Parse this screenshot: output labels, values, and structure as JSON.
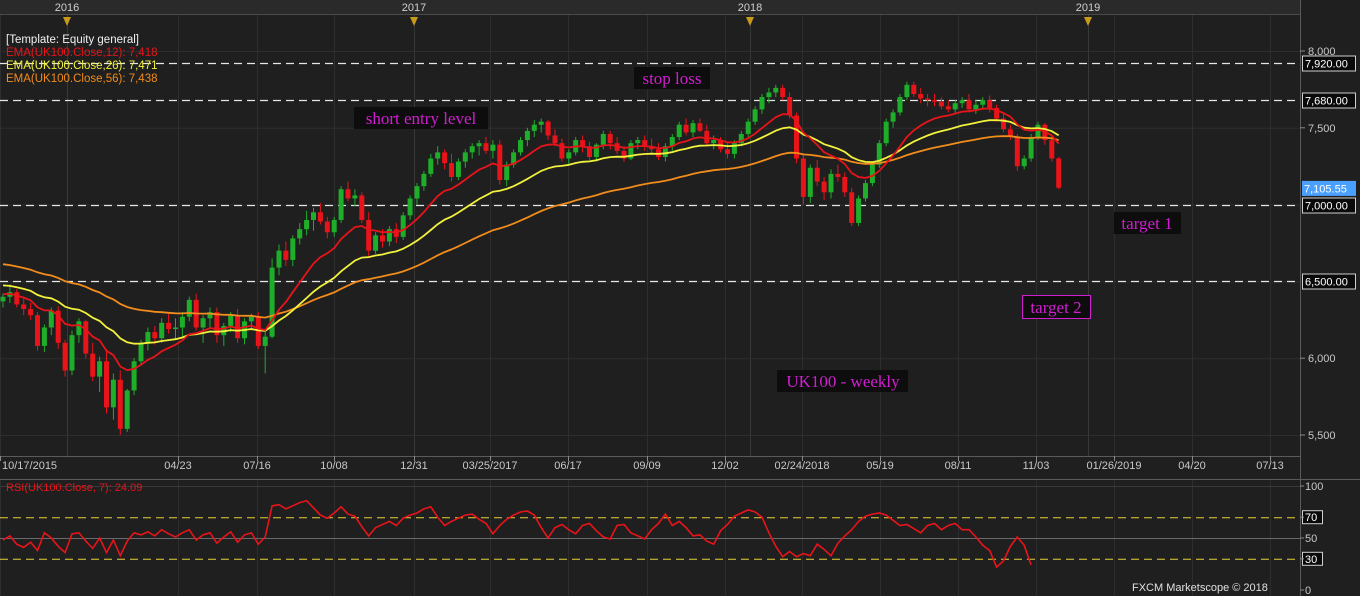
{
  "template_label": "[Template: Equity general]",
  "ema_legend": [
    {
      "label": "EMA(UK100.Close,12): 7,418",
      "color": "#e8141a"
    },
    {
      "label": "EMA(UK100.Close,26): 7,471",
      "color": "#f2f23c"
    },
    {
      "label": "EMA(UK100.Close,56): 7,438",
      "color": "#f28c1c"
    }
  ],
  "year_markers": [
    "2016",
    "2017",
    "2018",
    "2019"
  ],
  "date_labels": [
    "10/17/2015",
    "04/23",
    "07/16",
    "10/08",
    "12/31",
    "03/25/2017",
    "06/17",
    "09/09",
    "12/02",
    "02/24/2018",
    "05/19",
    "08/11",
    "11/03",
    "01/26/2019",
    "04/20",
    "07/13"
  ],
  "annotations": {
    "stop_loss": "stop loss",
    "short_entry": "short entry level",
    "target1": "target 1",
    "target2": "target 2",
    "title": "UK100 - weekly"
  },
  "levels": [
    {
      "value": 7920,
      "label": "7,920.00"
    },
    {
      "value": 7680,
      "label": "7,680.00"
    },
    {
      "value": 7000,
      "label": "7,000.00"
    },
    {
      "value": 6500,
      "label": "6,500.00"
    }
  ],
  "current_price": {
    "value": 7105.55,
    "label": "7,105.55"
  },
  "price_ticks": [
    {
      "value": 8000,
      "label": "8,000"
    },
    {
      "value": 7500,
      "label": "7,500"
    },
    {
      "value": 6000,
      "label": "6,000"
    },
    {
      "value": 5500,
      "label": "5,500"
    }
  ],
  "rsi_label": "RSI(UK100.Close, 7): 24.09",
  "rsi_ticks": [
    {
      "value": 100,
      "label": "100"
    },
    {
      "value": 70,
      "label": "70"
    },
    {
      "value": 50,
      "label": "50"
    },
    {
      "value": 30,
      "label": "30"
    },
    {
      "value": 0,
      "label": "0"
    }
  ],
  "watermark": "FXCM Marketscope © 2018",
  "colors": {
    "up": "#1fae2a",
    "down": "#e8141a",
    "rsi": "#e8141a",
    "annotation": "#d21ed2",
    "current": "#4aa0ff"
  },
  "chart_data": {
    "type": "candlestick",
    "title": "UK100 - weekly",
    "price_range": [
      5500,
      8060
    ],
    "rsi_range": [
      0,
      100
    ],
    "ohlc": [
      [
        6370,
        6420,
        6330,
        6400
      ],
      [
        6400,
        6480,
        6360,
        6430
      ],
      [
        6430,
        6450,
        6330,
        6350
      ],
      [
        6350,
        6390,
        6280,
        6320
      ],
      [
        6320,
        6360,
        6250,
        6280
      ],
      [
        6280,
        6300,
        6050,
        6080
      ],
      [
        6080,
        6220,
        6040,
        6200
      ],
      [
        6200,
        6330,
        6150,
        6310
      ],
      [
        6310,
        6340,
        6060,
        6100
      ],
      [
        6100,
        6120,
        5880,
        5920
      ],
      [
        5920,
        6180,
        5890,
        6150
      ],
      [
        6150,
        6260,
        6100,
        6240
      ],
      [
        6240,
        6250,
        6000,
        6030
      ],
      [
        6030,
        6100,
        5850,
        5880
      ],
      [
        5880,
        6010,
        5780,
        5980
      ],
      [
        5980,
        6060,
        5640,
        5680
      ],
      [
        5680,
        5900,
        5600,
        5860
      ],
      [
        5860,
        5920,
        5500,
        5540
      ],
      [
        5540,
        5800,
        5520,
        5790
      ],
      [
        5790,
        6000,
        5760,
        5980
      ],
      [
        5980,
        6120,
        5950,
        6100
      ],
      [
        6100,
        6200,
        6050,
        6170
      ],
      [
        6170,
        6210,
        6090,
        6130
      ],
      [
        6130,
        6260,
        6100,
        6230
      ],
      [
        6230,
        6300,
        6160,
        6190
      ],
      [
        6190,
        6260,
        6120,
        6200
      ],
      [
        6200,
        6300,
        6140,
        6270
      ],
      [
        6270,
        6400,
        6240,
        6380
      ],
      [
        6380,
        6420,
        6180,
        6200
      ],
      [
        6200,
        6280,
        6100,
        6260
      ],
      [
        6260,
        6330,
        6200,
        6300
      ],
      [
        6300,
        6330,
        6100,
        6150
      ],
      [
        6150,
        6230,
        6080,
        6210
      ],
      [
        6210,
        6300,
        6170,
        6280
      ],
      [
        6280,
        6320,
        6100,
        6130
      ],
      [
        6130,
        6260,
        6090,
        6240
      ],
      [
        6240,
        6290,
        6180,
        6270
      ],
      [
        6270,
        6300,
        6060,
        6080
      ],
      [
        6080,
        6170,
        5900,
        6140
      ],
      [
        6140,
        6650,
        6130,
        6590
      ],
      [
        6590,
        6740,
        6540,
        6700
      ],
      [
        6700,
        6760,
        6600,
        6640
      ],
      [
        6640,
        6800,
        6600,
        6780
      ],
      [
        6780,
        6880,
        6740,
        6840
      ],
      [
        6840,
        6960,
        6800,
        6900
      ],
      [
        6900,
        6980,
        6830,
        6950
      ],
      [
        6950,
        7010,
        6870,
        6890
      ],
      [
        6890,
        6920,
        6780,
        6820
      ],
      [
        6820,
        6920,
        6790,
        6900
      ],
      [
        6900,
        7120,
        6880,
        7100
      ],
      [
        7100,
        7150,
        7020,
        7040
      ],
      [
        7040,
        7100,
        6990,
        7060
      ],
      [
        7060,
        7080,
        6880,
        6900
      ],
      [
        6900,
        6950,
        6660,
        6700
      ],
      [
        6700,
        6820,
        6680,
        6800
      ],
      [
        6800,
        6840,
        6720,
        6760
      ],
      [
        6760,
        6860,
        6730,
        6840
      ],
      [
        6840,
        6880,
        6750,
        6790
      ],
      [
        6790,
        6950,
        6770,
        6930
      ],
      [
        6930,
        7060,
        6900,
        7040
      ],
      [
        7040,
        7140,
        7000,
        7120
      ],
      [
        7120,
        7220,
        7090,
        7200
      ],
      [
        7200,
        7330,
        7180,
        7300
      ],
      [
        7300,
        7380,
        7260,
        7340
      ],
      [
        7340,
        7360,
        7230,
        7270
      ],
      [
        7270,
        7330,
        7150,
        7180
      ],
      [
        7180,
        7300,
        7160,
        7280
      ],
      [
        7280,
        7360,
        7240,
        7340
      ],
      [
        7340,
        7400,
        7300,
        7380
      ],
      [
        7380,
        7420,
        7320,
        7400
      ],
      [
        7400,
        7440,
        7330,
        7350
      ],
      [
        7350,
        7420,
        7300,
        7390
      ],
      [
        7390,
        7420,
        7130,
        7160
      ],
      [
        7160,
        7280,
        7120,
        7260
      ],
      [
        7260,
        7360,
        7240,
        7340
      ],
      [
        7340,
        7440,
        7320,
        7420
      ],
      [
        7420,
        7500,
        7380,
        7480
      ],
      [
        7480,
        7550,
        7440,
        7520
      ],
      [
        7520,
        7560,
        7470,
        7540
      ],
      [
        7540,
        7550,
        7420,
        7450
      ],
      [
        7450,
        7490,
        7380,
        7400
      ],
      [
        7400,
        7430,
        7280,
        7300
      ],
      [
        7300,
        7360,
        7260,
        7340
      ],
      [
        7340,
        7440,
        7320,
        7420
      ],
      [
        7420,
        7450,
        7340,
        7380
      ],
      [
        7380,
        7410,
        7290,
        7310
      ],
      [
        7310,
        7400,
        7280,
        7390
      ],
      [
        7390,
        7480,
        7360,
        7460
      ],
      [
        7460,
        7480,
        7360,
        7400
      ],
      [
        7400,
        7440,
        7330,
        7350
      ],
      [
        7350,
        7380,
        7280,
        7300
      ],
      [
        7300,
        7420,
        7290,
        7400
      ],
      [
        7400,
        7440,
        7360,
        7420
      ],
      [
        7420,
        7450,
        7350,
        7380
      ],
      [
        7380,
        7430,
        7330,
        7360
      ],
      [
        7360,
        7400,
        7290,
        7310
      ],
      [
        7310,
        7400,
        7280,
        7380
      ],
      [
        7380,
        7460,
        7350,
        7440
      ],
      [
        7440,
        7540,
        7420,
        7520
      ],
      [
        7520,
        7560,
        7450,
        7470
      ],
      [
        7470,
        7550,
        7440,
        7530
      ],
      [
        7530,
        7560,
        7470,
        7480
      ],
      [
        7480,
        7520,
        7380,
        7400
      ],
      [
        7400,
        7450,
        7360,
        7420
      ],
      [
        7420,
        7440,
        7340,
        7360
      ],
      [
        7360,
        7400,
        7300,
        7330
      ],
      [
        7330,
        7420,
        7300,
        7400
      ],
      [
        7400,
        7480,
        7380,
        7460
      ],
      [
        7460,
        7560,
        7440,
        7540
      ],
      [
        7540,
        7640,
        7520,
        7620
      ],
      [
        7620,
        7720,
        7590,
        7700
      ],
      [
        7700,
        7760,
        7660,
        7730
      ],
      [
        7730,
        7780,
        7700,
        7760
      ],
      [
        7760,
        7780,
        7680,
        7700
      ],
      [
        7700,
        7730,
        7560,
        7580
      ],
      [
        7580,
        7600,
        7270,
        7300
      ],
      [
        7300,
        7330,
        7000,
        7050
      ],
      [
        7050,
        7260,
        7010,
        7240
      ],
      [
        7240,
        7290,
        7120,
        7150
      ],
      [
        7150,
        7180,
        7030,
        7080
      ],
      [
        7080,
        7230,
        7040,
        7200
      ],
      [
        7200,
        7260,
        7150,
        7180
      ],
      [
        7180,
        7210,
        7050,
        7080
      ],
      [
        7080,
        7110,
        6860,
        6880
      ],
      [
        6880,
        7060,
        6860,
        7040
      ],
      [
        7040,
        7160,
        7020,
        7140
      ],
      [
        7140,
        7280,
        7120,
        7260
      ],
      [
        7260,
        7420,
        7240,
        7400
      ],
      [
        7400,
        7560,
        7380,
        7540
      ],
      [
        7540,
        7620,
        7500,
        7600
      ],
      [
        7600,
        7720,
        7580,
        7700
      ],
      [
        7700,
        7800,
        7680,
        7780
      ],
      [
        7780,
        7800,
        7700,
        7720
      ],
      [
        7720,
        7760,
        7660,
        7690
      ],
      [
        7690,
        7720,
        7640,
        7680
      ],
      [
        7680,
        7720,
        7640,
        7670
      ],
      [
        7670,
        7700,
        7620,
        7640
      ],
      [
        7640,
        7680,
        7600,
        7620
      ],
      [
        7620,
        7680,
        7590,
        7660
      ],
      [
        7660,
        7700,
        7630,
        7680
      ],
      [
        7680,
        7720,
        7600,
        7620
      ],
      [
        7620,
        7680,
        7590,
        7650
      ],
      [
        7650,
        7700,
        7620,
        7680
      ],
      [
        7680,
        7710,
        7600,
        7630
      ],
      [
        7630,
        7650,
        7540,
        7560
      ],
      [
        7560,
        7590,
        7470,
        7490
      ],
      [
        7490,
        7520,
        7420,
        7440
      ],
      [
        7440,
        7460,
        7220,
        7250
      ],
      [
        7250,
        7320,
        7230,
        7300
      ],
      [
        7300,
        7460,
        7280,
        7440
      ],
      [
        7440,
        7540,
        7420,
        7520
      ],
      [
        7520,
        7530,
        7390,
        7420
      ],
      [
        7420,
        7440,
        7280,
        7300
      ],
      [
        7300,
        7310,
        7100,
        7110
      ]
    ],
    "rsi": [
      48,
      52,
      44,
      41,
      46,
      38,
      55,
      50,
      42,
      36,
      54,
      55,
      47,
      40,
      50,
      36,
      48,
      33,
      47,
      55,
      53,
      56,
      52,
      58,
      54,
      51,
      55,
      58,
      48,
      53,
      55,
      45,
      51,
      56,
      46,
      53,
      55,
      44,
      51,
      81,
      82,
      78,
      81,
      84,
      86,
      79,
      72,
      69,
      74,
      80,
      73,
      71,
      61,
      52,
      60,
      63,
      66,
      62,
      69,
      72,
      74,
      78,
      80,
      70,
      62,
      66,
      69,
      72,
      73,
      68,
      64,
      54,
      62,
      68,
      72,
      75,
      76,
      72,
      60,
      50,
      60,
      63,
      58,
      54,
      62,
      64,
      57,
      51,
      49,
      62,
      63,
      55,
      52,
      49,
      58,
      64,
      73,
      62,
      66,
      60,
      52,
      53,
      47,
      44,
      57,
      63,
      71,
      74,
      77,
      75,
      70,
      55,
      42,
      32,
      37,
      32,
      35,
      33,
      44,
      39,
      33,
      45,
      52,
      58,
      66,
      71,
      73,
      74,
      72,
      67,
      62,
      63,
      59,
      55,
      62,
      64,
      58,
      62,
      64,
      58,
      58,
      51,
      43,
      38,
      22,
      28,
      42,
      51,
      43,
      24
    ]
  }
}
